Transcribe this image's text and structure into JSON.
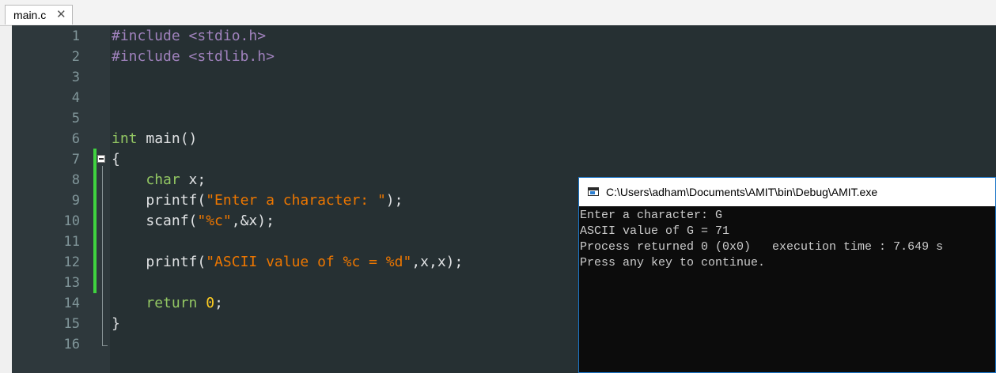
{
  "tab": {
    "label": "main.c",
    "close_glyph": "✕"
  },
  "editor": {
    "line_numbers": [
      "1",
      "2",
      "3",
      "4",
      "5",
      "6",
      "7",
      "8",
      "9",
      "10",
      "11",
      "12",
      "13",
      "14",
      "15",
      "16"
    ],
    "code": {
      "l1": "#include <stdio.h>",
      "l2": "#include <stdlib.h>",
      "l6_kw": "int",
      "l6_rest": " main()",
      "l7": "{",
      "l8_indent": "    ",
      "l8_kw": "char",
      "l8_rest": " x;",
      "l9_fn": "    printf(",
      "l9_str": "\"Enter a character: \"",
      "l9_end": ");",
      "l10_fn": "    scanf(",
      "l10_str": "\"%c\"",
      "l10_end": ",&x);",
      "l12_fn": "    printf(",
      "l12_str": "\"ASCII value of %c = %d\"",
      "l12_end": ",x,x);",
      "l14_indent": "    ",
      "l14_kw": "return",
      "l14_sp": " ",
      "l14_num": "0",
      "l14_end": ";",
      "l15": "}"
    }
  },
  "console": {
    "title": "C:\\Users\\adham\\Documents\\AMIT\\bin\\Debug\\AMIT.exe",
    "lines": [
      "Enter a character: G",
      "ASCII value of G = 71",
      "Process returned 0 (0x0)   execution time : 7.649 s",
      "Press any key to continue."
    ]
  },
  "colors": {
    "editor_bg": "#263033",
    "gutter_bg": "#2e383c",
    "keyword": "#93c763",
    "preprocessor": "#a082bd",
    "string": "#ec7600",
    "number": "#ffcd22",
    "change_marker": "#3fd33f",
    "console_bg": "#0c0c0c"
  }
}
